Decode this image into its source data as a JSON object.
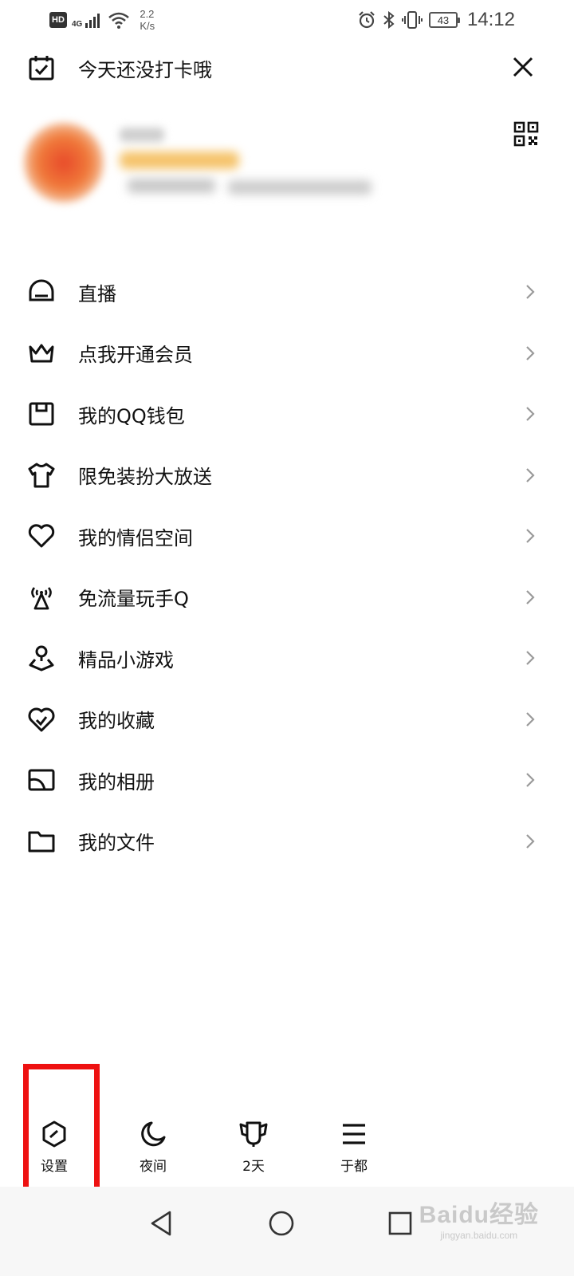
{
  "status_bar": {
    "hd": "HD",
    "network": "4G",
    "speed_value": "2.2",
    "speed_unit": "K/s",
    "battery": "43",
    "time": "14:12",
    "icons": [
      "signal-icon",
      "wifi-icon",
      "alarm-icon",
      "bluetooth-icon",
      "vibrate-icon"
    ]
  },
  "header": {
    "checkin_text": "今天还没打卡哦"
  },
  "menu": {
    "items": [
      {
        "label": "直播",
        "icon": "live-icon"
      },
      {
        "label": "点我开通会员",
        "icon": "crown-icon"
      },
      {
        "label": "我的QQ钱包",
        "icon": "wallet-icon"
      },
      {
        "label": "限免装扮大放送",
        "icon": "tshirt-icon"
      },
      {
        "label": "我的情侣空间",
        "icon": "heart-icon"
      },
      {
        "label": "免流量玩手Q",
        "icon": "antenna-icon"
      },
      {
        "label": "精品小游戏",
        "icon": "game-icon"
      },
      {
        "label": "我的收藏",
        "icon": "favorite-icon"
      },
      {
        "label": "我的相册",
        "icon": "album-icon"
      },
      {
        "label": "我的文件",
        "icon": "folder-icon"
      }
    ]
  },
  "bottom_bar": {
    "settings": "设置",
    "night": "夜间",
    "days": "2天",
    "location": "于都"
  },
  "watermark": {
    "big": "Baidu经验",
    "small": "jingyan.baidu.com"
  },
  "colors": {
    "highlight": "#ee1111",
    "text": "#111111",
    "chevron": "#9a9a9a"
  }
}
